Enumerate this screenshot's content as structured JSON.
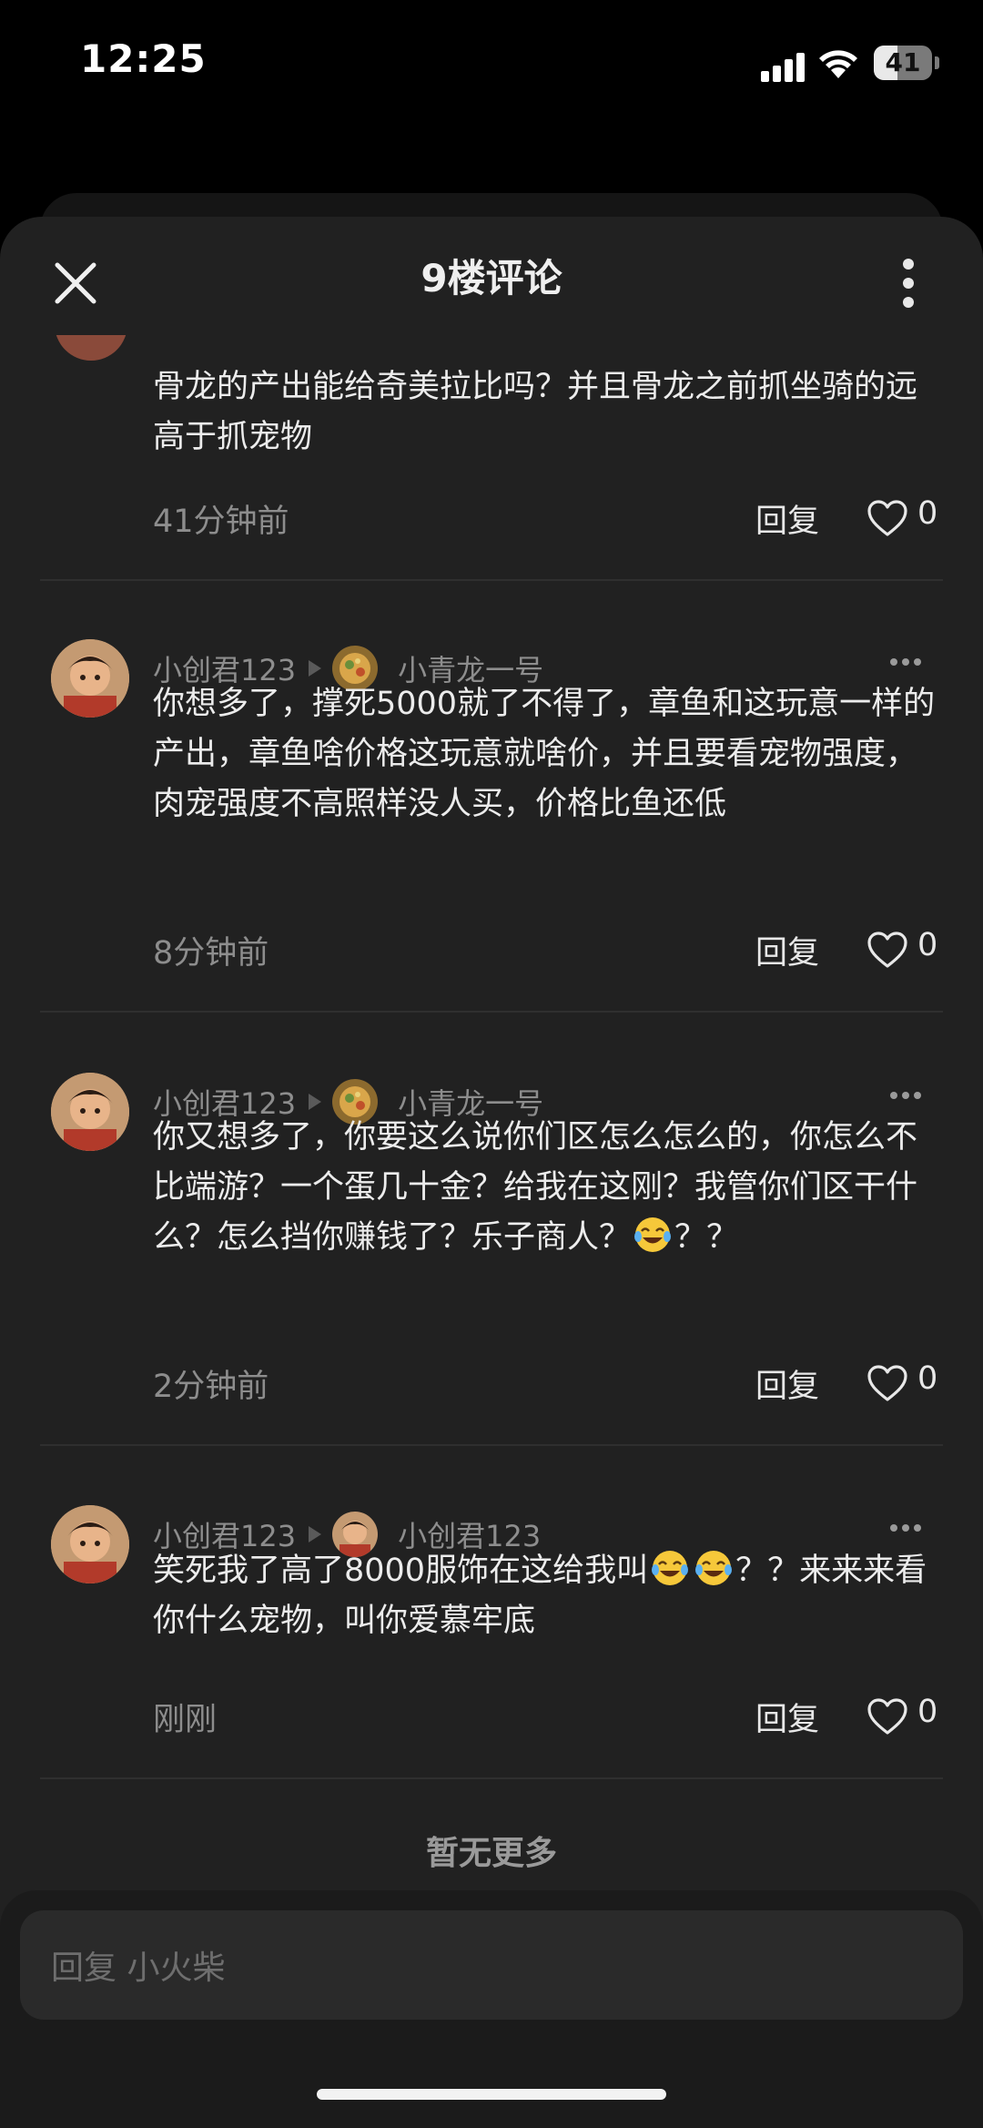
{
  "status_bar": {
    "time": "12:25",
    "battery": "41",
    "battery_level": 0.41
  },
  "header": {
    "title": "9楼评论"
  },
  "partial_comment": {
    "text": "骨龙的产出能给奇美拉比吗？并且骨龙之前抓坐骑的远高于抓宠物",
    "time": "41分钟前",
    "reply_label": "回复",
    "likes": "0"
  },
  "comments": [
    {
      "author": "小创君123",
      "reply_to": "小青龙一号",
      "text": "你想多了，撑死5000就了不得了，章鱼和这玩意一样的产出，章鱼啥价格这玩意就啥价，并且要看宠物强度，肉宠强度不高照样没人买，价格比鱼还低",
      "time": "8分钟前",
      "reply_label": "回复",
      "likes": "0"
    },
    {
      "author": "小创君123",
      "reply_to": "小青龙一号",
      "text_before_emoji": "你又想多了，你要这么说你们区怎么怎么的，你怎么不比端游？一个蛋几十金？给我在这刚？我管你们区干什么？怎么挡你赚钱了？乐子商人？",
      "text_after_emoji": "？？",
      "time": "2分钟前",
      "reply_label": "回复",
      "likes": "0"
    },
    {
      "author": "小创君123",
      "reply_to": "小创君123",
      "text_before_emoji": "笑死我了高了8000服饰在这给我叫",
      "text_after_emoji": "？？来来来看你什么宠物，叫你爱慕牢底",
      "time": "刚刚",
      "reply_label": "回复",
      "likes": "0"
    }
  ],
  "footer": {
    "no_more": "暂无更多"
  },
  "reply_box": {
    "placeholder": "回复 小火柴"
  },
  "icons": {
    "close": "close-icon",
    "more": "more-vertical-icon",
    "like": "heart-outline-icon",
    "emoji": "tears-of-joy-emoji"
  },
  "colors": {
    "background": "#000000",
    "sheet": "#212121",
    "muted_text": "#8d8d8d",
    "text": "#ececec"
  }
}
